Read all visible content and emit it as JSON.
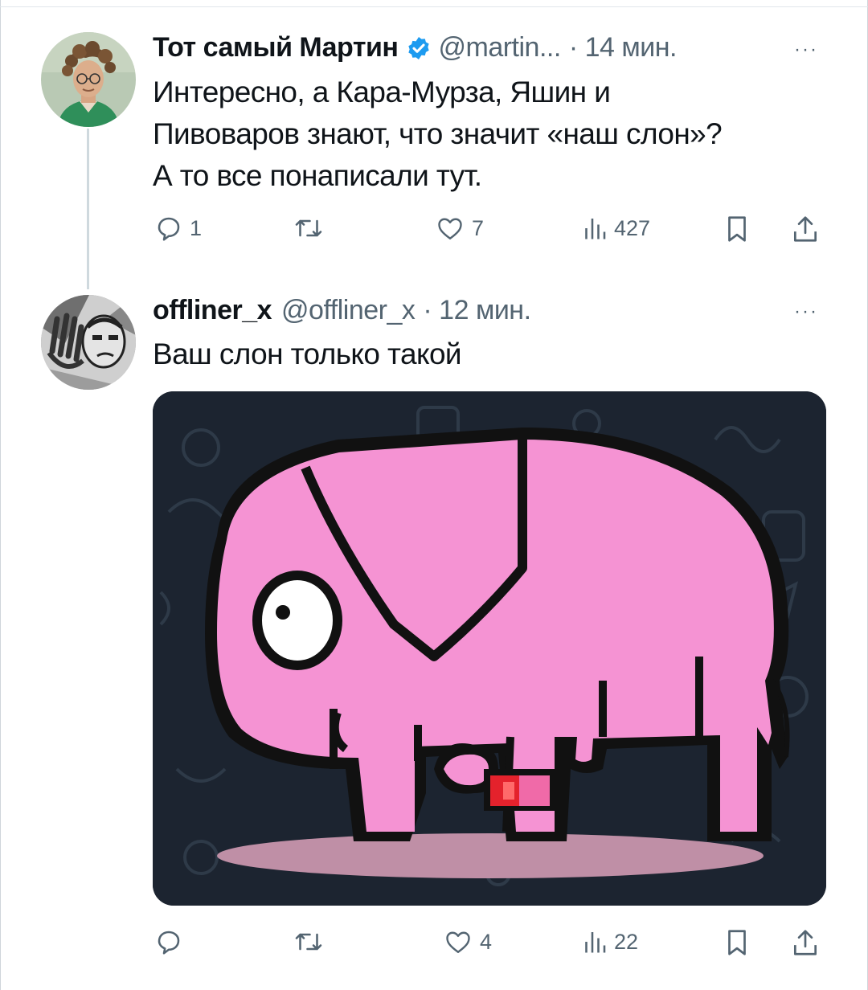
{
  "tweets": [
    {
      "display_name": "Тот самый Мартин",
      "handle": "@martin...",
      "time": "· 14 мин.",
      "more": "···",
      "text_lines": [
        "Интересно, а Кара-Мурза, Яшин и",
        "Пивоваров знают, что значит «наш слон»?",
        "А то все понаписали тут."
      ],
      "verified": true,
      "stats": {
        "replies": "1",
        "retweets": "",
        "likes": "7",
        "views": "427"
      }
    },
    {
      "display_name": "offliner_x",
      "handle": "@offliner_x",
      "time": "· 12 мин.",
      "more": "···",
      "text_lines": [
        "Ваш слон только такой"
      ],
      "verified": false,
      "stats": {
        "replies": "",
        "retweets": "",
        "likes": "4",
        "views": "22"
      }
    }
  ],
  "icons": [
    "reply-icon",
    "retweet-icon",
    "like-icon",
    "views-icon",
    "bookmark-icon",
    "share-icon",
    "verified-badge-icon"
  ],
  "colors": {
    "text": "#0f1419",
    "secondary": "#536471",
    "verified": "#1d9bf0",
    "elephant": "#f593d3",
    "media_bg": "#1c2430"
  }
}
